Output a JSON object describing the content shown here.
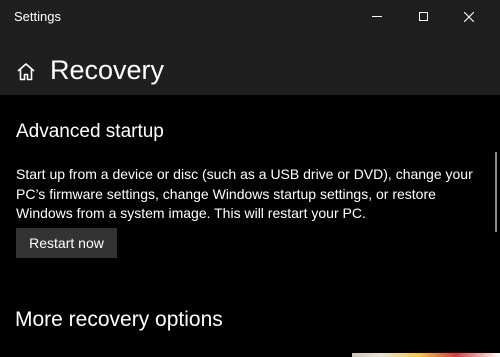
{
  "window": {
    "title": "Settings",
    "controls": {
      "minimize_icon": "minimize-icon",
      "maximize_icon": "maximize-icon",
      "close_icon": "close-icon"
    }
  },
  "header": {
    "home_icon": "home-icon",
    "title": "Recovery"
  },
  "advanced_startup": {
    "heading": "Advanced startup",
    "description": "Start up from a device or disc (such as a USB drive or DVD), change your PC’s firmware settings, change Windows startup settings, or restore Windows from a system image. This will restart your PC.",
    "button_label": "Restart now"
  },
  "more_options": {
    "heading": "More recovery options"
  },
  "colors": {
    "titlebar_bg": "#1f1f1f",
    "content_bg": "#000000",
    "button_bg": "#333333",
    "text": "#ffffff"
  }
}
